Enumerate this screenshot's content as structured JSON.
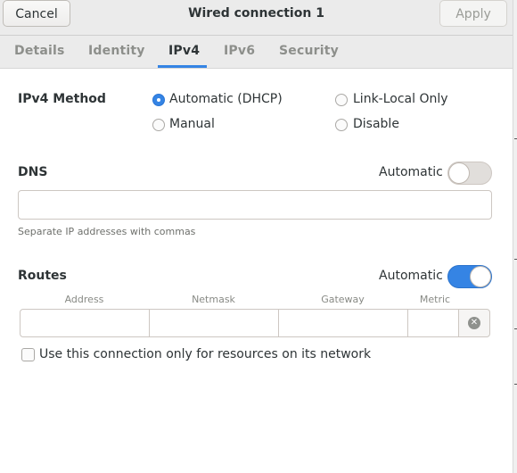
{
  "header": {
    "cancel_label": "Cancel",
    "title": "Wired connection 1",
    "apply_label": "Apply"
  },
  "tabs": [
    {
      "label": "Details"
    },
    {
      "label": "Identity"
    },
    {
      "label": "IPv4",
      "active": true
    },
    {
      "label": "IPv6"
    },
    {
      "label": "Security"
    }
  ],
  "ipv4_method": {
    "label": "IPv4 Method",
    "options": [
      "Automatic (DHCP)",
      "Link-Local Only",
      "Manual",
      "Disable"
    ],
    "selected": "Automatic (DHCP)"
  },
  "dns": {
    "label": "DNS",
    "automatic_label": "Automatic",
    "automatic_on": false,
    "value": "",
    "hint": "Separate IP addresses with commas"
  },
  "routes": {
    "label": "Routes",
    "automatic_label": "Automatic",
    "automatic_on": true,
    "columns": [
      "Address",
      "Netmask",
      "Gateway",
      "Metric"
    ]
  },
  "only_local": {
    "label": "Use this connection only for resources on its network",
    "checked": false
  },
  "colors": {
    "accent": "#3584e4",
    "header_bg": "#ebebeb"
  },
  "icons": {
    "delete_route": "remove-circle-icon"
  }
}
